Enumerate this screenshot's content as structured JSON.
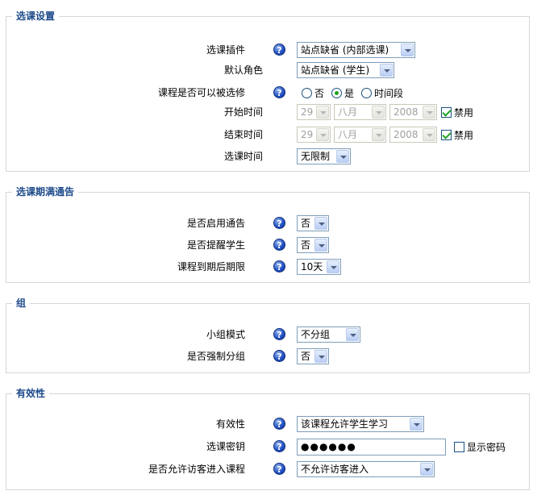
{
  "section1": {
    "legend": "选课设置",
    "plugin_label": "选课插件",
    "plugin_value": "站点缺省 (内部选课)",
    "role_label": "默认角色",
    "role_value": "站点缺省 (学生)",
    "enrollable_label": "课程是否可以被选修",
    "enrollable_options": [
      "否",
      "是",
      "时间段"
    ],
    "enrollable_selected": "是",
    "start_label": "开始时间",
    "start_day": "29",
    "start_month": "八月",
    "start_year": "2008",
    "start_disable": "禁用",
    "end_label": "结束时间",
    "end_day": "29",
    "end_month": "八月",
    "end_year": "2008",
    "end_disable": "禁用",
    "period_label": "选课时间",
    "period_value": "无限制"
  },
  "section2": {
    "legend": "选课期满通告",
    "notify_label": "是否启用通告",
    "notify_value": "否",
    "remind_label": "是否提醒学生",
    "remind_value": "否",
    "threshold_label": "课程到期后期限",
    "threshold_value": "10天"
  },
  "section3": {
    "legend": "组",
    "groupmode_label": "小组模式",
    "groupmode_value": "不分组",
    "force_label": "是否强制分组",
    "force_value": "否"
  },
  "section4": {
    "legend": "有效性",
    "visible_label": "有效性",
    "visible_value": "该课程允许学生学习",
    "key_label": "选课密钥",
    "key_value": "●●●●●●",
    "show_password": "显示密码",
    "guest_label": "是否允许访客进入课程",
    "guest_value": "不允许访客进入"
  },
  "icons": {
    "help": "help-icon",
    "help_glyph": "?"
  },
  "colors": {
    "legend": "#1c4a8a",
    "help": "#1f4ec2"
  }
}
